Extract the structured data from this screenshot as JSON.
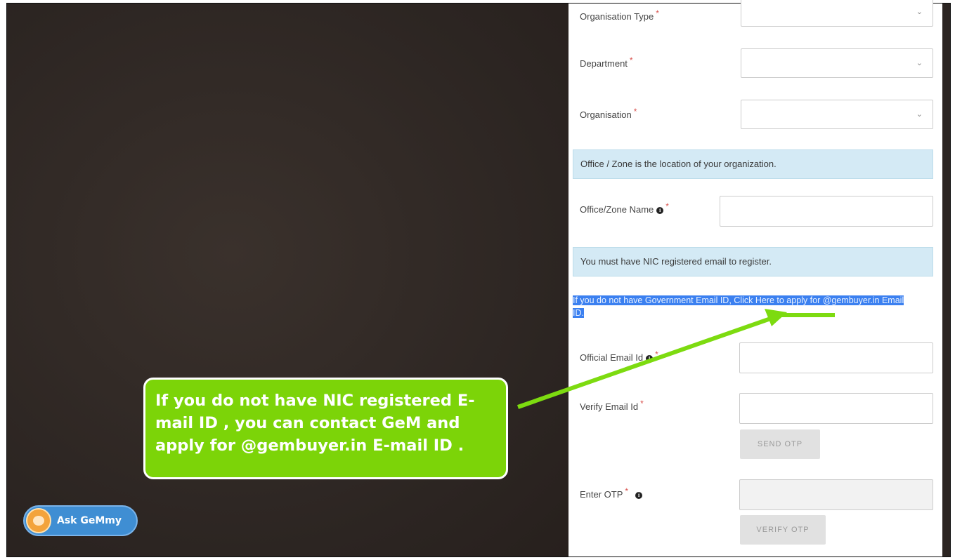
{
  "form": {
    "organisation_type_label": "Organisation Type",
    "department_label": "Department",
    "organisation_label": "Organisation",
    "office_notice": "Office / Zone is the location of your organization.",
    "office_zone_label": "Office/Zone Name",
    "nic_notice": "You must have NIC registered email to register.",
    "gov_email_link": "If you do not have Government Email ID, Click Here to apply for @gembuyer.in Email ID.",
    "official_email_label": "Official Email Id",
    "verify_email_label": "Verify Email Id",
    "send_otp_label": "SEND OTP",
    "enter_otp_label": "Enter OTP",
    "verify_otp_label": "VERIFY OTP",
    "required_mark": "*",
    "info_glyph": "i"
  },
  "callout": {
    "text": "If you do not have NIC registered E-mail ID  , you can contact GeM and apply for @gembuyer.in E-mail ID ."
  },
  "assistant": {
    "label": "Ask GeMmy"
  },
  "colors": {
    "callout_bg": "#7cd408",
    "arrow": "#7ddb10",
    "highlight": "#3b80f0",
    "notice_bg": "#d4eaf5",
    "assistant_bg": "#3f8ed3"
  },
  "icons": {
    "dropdown": "chevron-down-icon",
    "info": "info-circle-icon",
    "assistant_avatar": "mascot-icon"
  }
}
